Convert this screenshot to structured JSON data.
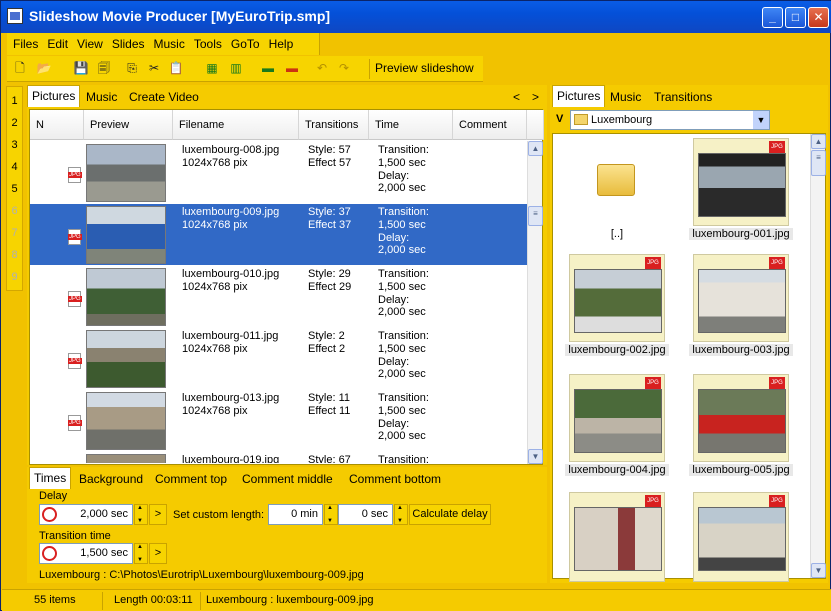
{
  "window": {
    "title": "Slideshow Movie Producer [MyEuroTrip.smp]"
  },
  "menu": [
    "Files",
    "Edit",
    "View",
    "Slides",
    "Music",
    "Tools",
    "GoTo",
    "Help"
  ],
  "toolbar": {
    "preview_label": "Preview slideshow"
  },
  "left_numbers": [
    "1",
    "2",
    "3",
    "4",
    "5",
    "6",
    "7",
    "8",
    "9"
  ],
  "left_tabs": [
    "Pictures",
    "Music",
    "Create Video"
  ],
  "nav": {
    "prev": "<",
    "next": ">"
  },
  "grid": {
    "columns": [
      "N",
      "Preview",
      "Filename",
      "Transitions",
      "Time",
      "Comment"
    ],
    "rows": [
      {
        "file": "luxembourg-008.jpg\n1024x768 pix",
        "trans": "Style: 57\nEffect 57",
        "time": "Transition:\n1,500 sec\nDelay:\n2,000 sec",
        "selected": false
      },
      {
        "file": "luxembourg-009.jpg\n1024x768 pix",
        "trans": "Style: 37\nEffect 37",
        "time": "Transition:\n1,500 sec\nDelay:\n2,000 sec",
        "selected": true
      },
      {
        "file": "luxembourg-010.jpg\n1024x768 pix",
        "trans": "Style: 29\nEffect 29",
        "time": "Transition:\n1,500 sec\nDelay:\n2,000 sec",
        "selected": false
      },
      {
        "file": "luxembourg-011.jpg\n1024x768 pix",
        "trans": "Style: 2\nEffect 2",
        "time": "Transition:\n1,500 sec\nDelay:\n2,000 sec",
        "selected": false
      },
      {
        "file": "luxembourg-013.jpg\n1024x768 pix",
        "trans": "Style: 11\nEffect 11",
        "time": "Transition:\n1,500 sec\nDelay:\n2,000 sec",
        "selected": false
      },
      {
        "file": "luxembourg-019.jpg",
        "trans": "Style: 67",
        "time": "Transition:",
        "selected": false
      }
    ]
  },
  "bottom_tabs": [
    "Times",
    "Background",
    "Comment top",
    "Comment middle",
    "Comment bottom"
  ],
  "times": {
    "delay_label": "Delay",
    "delay_value": "2,000 sec",
    "custom_label": "Set custom length:",
    "min_value": "0 min",
    "sec_value": "0 sec",
    "calc_label": "Calculate delay",
    "transition_label": "Transition time",
    "transition_value": "1,500 sec",
    "path": "Luxembourg : C:\\Photos\\Eurotrip\\Luxembourg\\luxembourg-009.jpg",
    "arrow": ">"
  },
  "right_tabs": [
    "Pictures",
    "Music",
    "Transitions"
  ],
  "folder": {
    "drive": "V",
    "name": "Luxembourg"
  },
  "files": [
    "[..]",
    "luxembourg-001.jpg",
    "luxembourg-002.jpg",
    "luxembourg-003.jpg",
    "luxembourg-004.jpg",
    "luxembourg-005.jpg",
    "",
    ""
  ],
  "status": {
    "items": "55 items",
    "length": "Length 00:03:11",
    "current": "Luxembourg : luxembourg-009.jpg"
  }
}
